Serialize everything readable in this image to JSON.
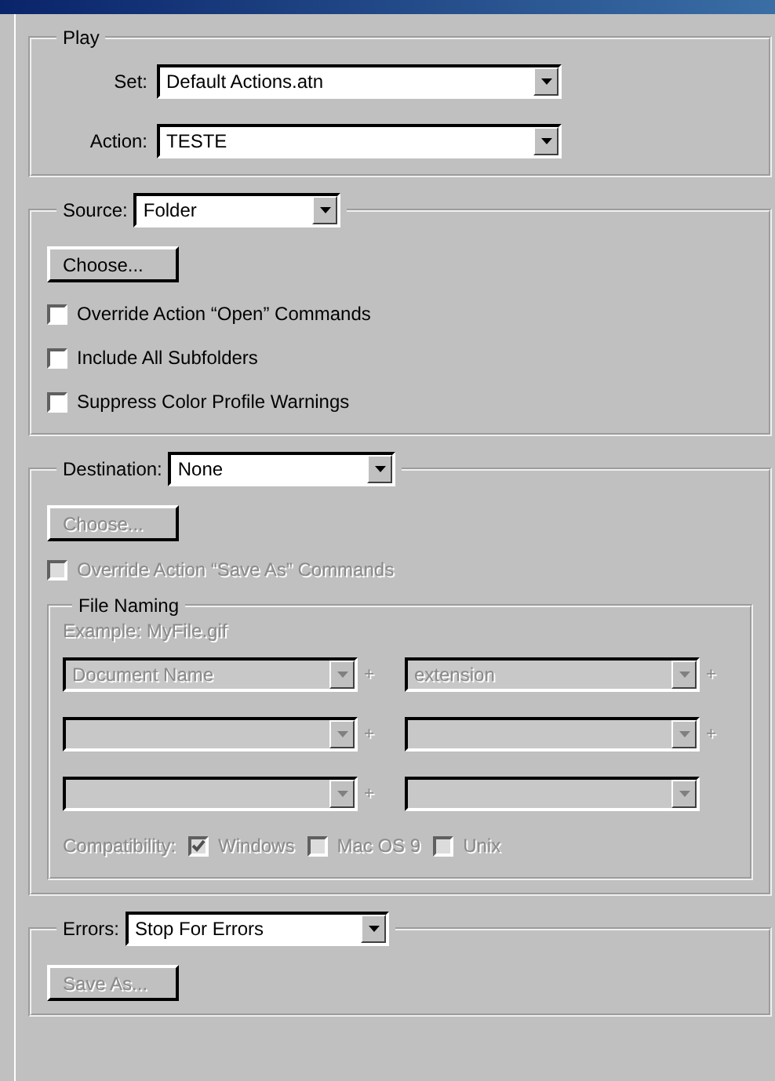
{
  "play": {
    "title": "Play",
    "fields": [
      {
        "label": "Set:",
        "value": "Default Actions.atn"
      },
      {
        "label": "Action:",
        "value": "TESTE"
      }
    ]
  },
  "source": {
    "label": "Source:",
    "value": "Folder",
    "button": {
      "label": "Choose...",
      "disabled": false
    },
    "options": [
      {
        "label": "Override Action “Open” Commands",
        "checked": false,
        "disabled": false
      },
      {
        "label": "Include All Subfolders",
        "checked": false,
        "disabled": false
      },
      {
        "label": "Suppress Color Profile Warnings",
        "checked": false,
        "disabled": false
      }
    ]
  },
  "destination": {
    "label": "Destination:",
    "value": "None",
    "button": {
      "label": "Choose...",
      "disabled": true
    },
    "options": [
      {
        "label": "Override Action “Save As” Commands",
        "checked": false,
        "disabled": true
      }
    ],
    "file_naming": {
      "title": "File Naming",
      "example": "Example: MyFile.gif",
      "disabled": true,
      "rows": [
        [
          {
            "value": "Document Name",
            "suffix": "+"
          },
          {
            "value": "extension",
            "suffix": "+"
          }
        ],
        [
          {
            "suffix": "+"
          },
          {
            "suffix": "+"
          }
        ],
        [
          {
            "suffix": "+"
          },
          {}
        ]
      ],
      "compatibility": {
        "label": "Compatibility:",
        "options": [
          {
            "label": "Windows",
            "checked": true,
            "disabled": true
          },
          {
            "label": "Mac OS 9",
            "checked": false,
            "disabled": true
          },
          {
            "label": "Unix",
            "checked": false,
            "disabled": true
          }
        ]
      }
    }
  },
  "errors": {
    "label": "Errors:",
    "value": "Stop For Errors",
    "button": {
      "label": "Save As...",
      "disabled": true
    }
  }
}
